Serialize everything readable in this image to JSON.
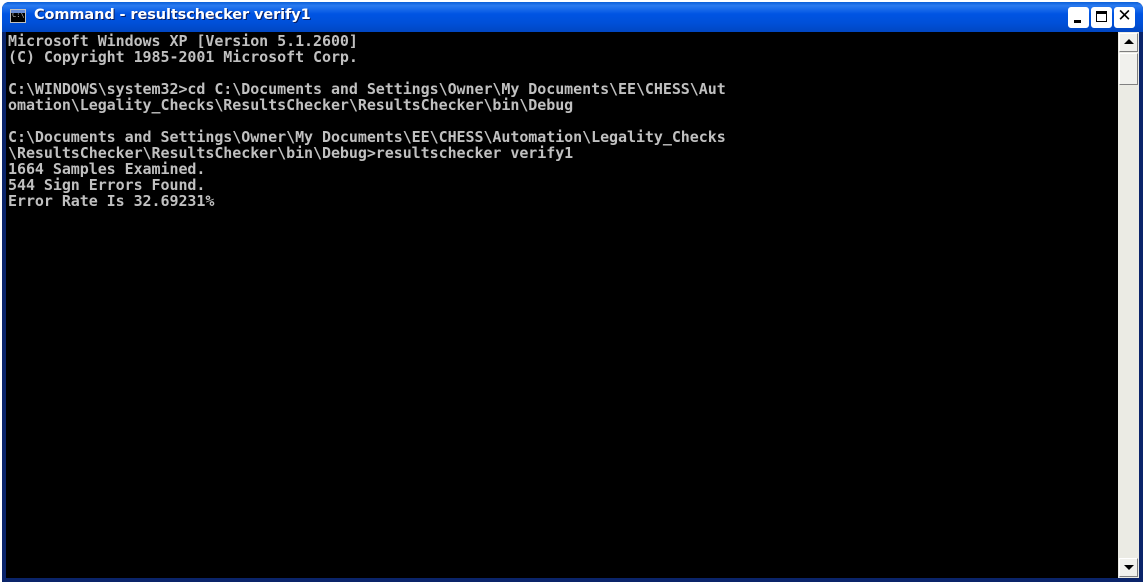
{
  "window": {
    "title": "Command - resultschecker verify1",
    "icon": "cmd-console-icon",
    "icon_text": "C:\\",
    "buttons": {
      "minimize": "minimize-icon",
      "maximize": "maximize-icon",
      "close": "close-icon",
      "close_glyph": "✕"
    }
  },
  "console": {
    "lines": [
      "Microsoft Windows XP [Version 5.1.2600]",
      "(C) Copyright 1985-2001 Microsoft Corp.",
      "",
      "C:\\WINDOWS\\system32>cd C:\\Documents and Settings\\Owner\\My Documents\\EE\\CHESS\\Aut",
      "omation\\Legality_Checks\\ResultsChecker\\ResultsChecker\\bin\\Debug",
      "",
      "C:\\Documents and Settings\\Owner\\My Documents\\EE\\CHESS\\Automation\\Legality_Checks",
      "\\ResultsChecker\\ResultsChecker\\bin\\Debug>resultschecker verify1",
      "1664 Samples Examined.",
      "544 Sign Errors Found.",
      "Error Rate Is 32.69231%"
    ]
  },
  "colors": {
    "titlebar": "#0054e3",
    "console_bg": "#000000",
    "console_text": "#c0c0c0"
  }
}
